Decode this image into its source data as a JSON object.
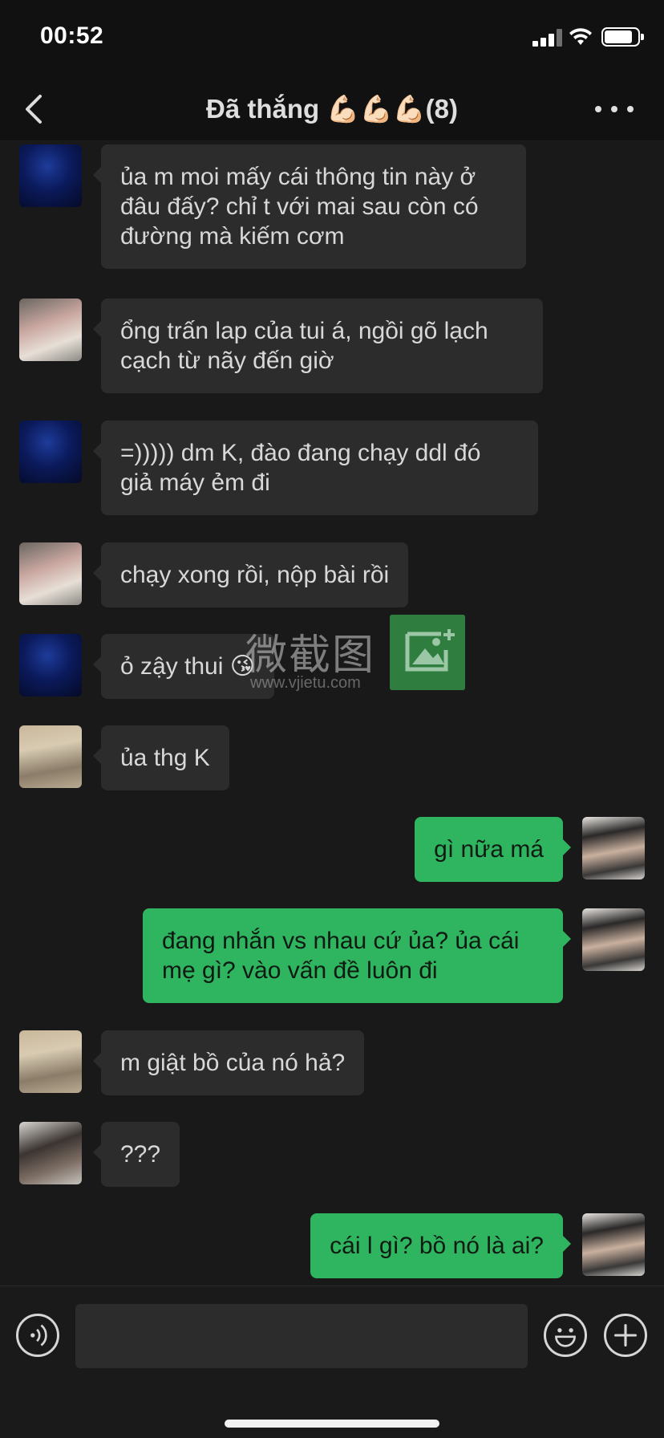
{
  "status_bar": {
    "time": "00:52"
  },
  "header": {
    "title": "Đã thắng 💪🏻💪🏻💪🏻(8)"
  },
  "messages": [
    {
      "side": "in",
      "avatar": "avatar-blue-portrait",
      "text": "ủa m moi mấy cái thông tin này ở đâu đấy? chỉ t với mai sau còn có đường mà kiếm cơm"
    },
    {
      "side": "in",
      "avatar": "avatar-pink-hair",
      "text": "ổng trấn lap của tui á, ngồi gõ lạch cạch từ nãy đến giờ"
    },
    {
      "side": "in",
      "avatar": "avatar-blue-portrait",
      "text": "=))))) dm K, đào đang chạy ddl đó giả máy ẻm đi"
    },
    {
      "side": "in",
      "avatar": "avatar-pink-hair",
      "text": "chạy xong rồi, nộp bài rồi"
    },
    {
      "side": "in",
      "avatar": "avatar-blue-portrait",
      "text": "ỏ zậy thui 😘"
    },
    {
      "side": "in",
      "avatar": "avatar-cap",
      "text": "ủa thg K"
    },
    {
      "side": "out",
      "avatar": "avatar-self",
      "text": "gì nữa má"
    },
    {
      "side": "out",
      "avatar": "avatar-self",
      "text": "đang nhắn vs nhau cứ ủa? ủa cái mẹ gì? vào vấn đề luôn đi"
    },
    {
      "side": "in",
      "avatar": "avatar-cap",
      "text": "m giật bồ của nó hả?"
    },
    {
      "side": "in",
      "avatar": "avatar-dark-hair",
      "text": "???"
    },
    {
      "side": "out",
      "avatar": "avatar-self",
      "text": "cái l gì? bồ nó là ai?"
    }
  ],
  "watermark": {
    "chinese": "微截图",
    "url": "www.vjietu.com"
  },
  "composer": {
    "input_value": "",
    "icons": [
      "voice-icon",
      "emoji-icon",
      "plus-icon"
    ]
  },
  "colors": {
    "outgoing_bubble": "#2fb55f",
    "incoming_bubble": "#2c2c2c",
    "chat_background": "#191919"
  }
}
